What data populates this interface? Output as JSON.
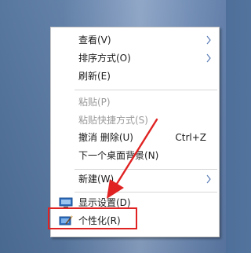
{
  "context_menu": {
    "items": [
      {
        "label": "查看(V)",
        "submenu": true,
        "disabled": false
      },
      {
        "label": "排序方式(O)",
        "submenu": true,
        "disabled": false
      },
      {
        "label": "刷新(E)",
        "submenu": false,
        "disabled": false
      },
      {
        "label": "粘贴(P)",
        "submenu": false,
        "disabled": true
      },
      {
        "label": "粘贴快捷方式(S)",
        "submenu": false,
        "disabled": true
      },
      {
        "label": "撤消 删除(U)",
        "shortcut": "Ctrl+Z",
        "submenu": false,
        "disabled": false
      },
      {
        "label": "下一个桌面背景(N)",
        "submenu": false,
        "disabled": false
      },
      {
        "label": "新建(W)",
        "submenu": true,
        "disabled": false
      },
      {
        "label": "显示设置(D)",
        "icon": "display-settings-icon",
        "submenu": false,
        "disabled": false
      },
      {
        "label": "个性化(R)",
        "icon": "personalize-icon",
        "submenu": false,
        "disabled": false
      }
    ]
  },
  "annotation": {
    "highlight_color": "#e02222",
    "arrow_color": "#e02222",
    "target": "个性化(R)"
  }
}
